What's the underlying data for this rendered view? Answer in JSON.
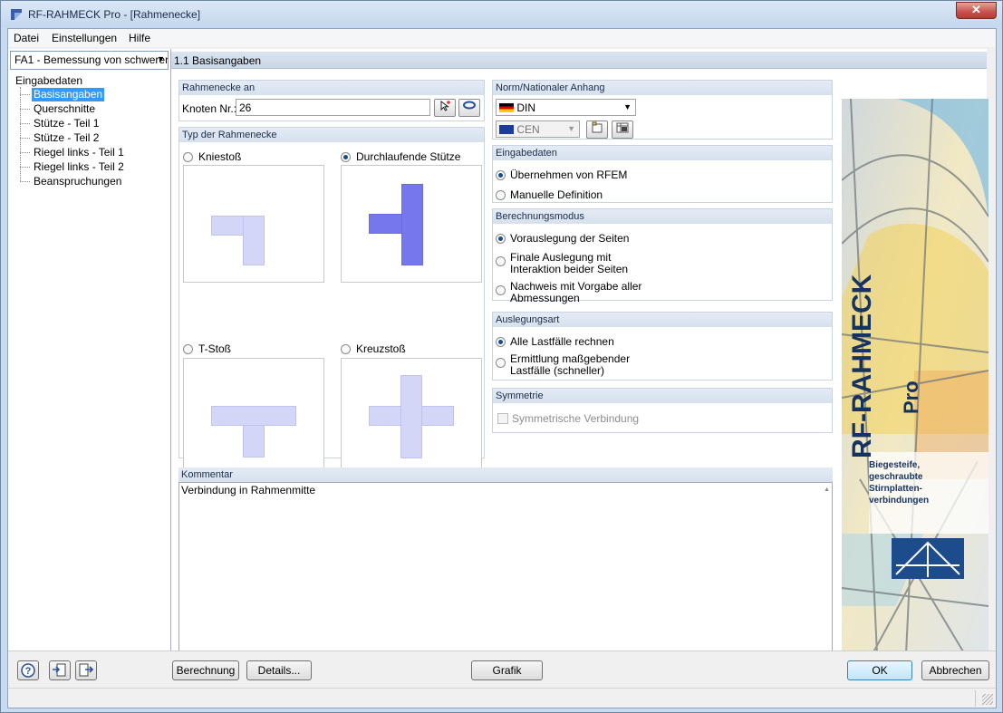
{
  "window": {
    "title": "RF-RAHMECK Pro - [Rahmenecke]",
    "close_glyph": "✕"
  },
  "menu": [
    "Datei",
    "Einstellungen",
    "Hilfe"
  ],
  "case_select": {
    "value": "FA1 - Bemessung von schwerer"
  },
  "tree": {
    "root": "Eingabedaten",
    "items": [
      "Basisangaben",
      "Querschnitte",
      "Stütze - Teil 1",
      "Stütze - Teil 2",
      "Riegel links - Teil 1",
      "Riegel links - Teil 2",
      "Beanspruchungen"
    ],
    "selected_index": 0
  },
  "main_header": "1.1 Basisangaben",
  "rahmenecke_an": {
    "title": "Rahmenecke an",
    "knoten_label": "Knoten Nr.:",
    "knoten_value": "26"
  },
  "typ": {
    "title": "Typ der Rahmenecke",
    "options": [
      "Kniestoß",
      "Durchlaufende Stütze",
      "T-Stoß",
      "Kreuzstoß"
    ],
    "selected_index": 1
  },
  "norm": {
    "title": "Norm/Nationaler Anhang",
    "norm_value": "DIN",
    "annex_value": "CEN"
  },
  "eingabedaten": {
    "title": "Eingabedaten",
    "options": [
      "Übernehmen von RFEM",
      "Manuelle Definition"
    ],
    "selected_index": 0
  },
  "berechnungsmodus": {
    "title": "Berechnungsmodus",
    "options": [
      {
        "line1": "Vorauslegung der Seiten",
        "line2": ""
      },
      {
        "line1": "Finale Auslegung mit",
        "line2": "Interaktion beider Seiten"
      },
      {
        "line1": "Nachweis mit Vorgabe aller",
        "line2": "Abmessungen"
      }
    ],
    "selected_index": 0
  },
  "auslegungsart": {
    "title": "Auslegungsart",
    "options": [
      {
        "line1": "Alle Lastfälle rechnen",
        "line2": ""
      },
      {
        "line1": "Ermittlung maßgebender",
        "line2": "Lastfälle (schneller)"
      }
    ],
    "selected_index": 0
  },
  "symmetrie": {
    "title": "Symmetrie",
    "checkbox_label": "Symmetrische Verbindung",
    "checked": false
  },
  "kommentar": {
    "title": "Kommentar",
    "text": "Verbindung in Rahmenmitte"
  },
  "side_banner": {
    "product": "RF-RAHMECK",
    "edition": "Pro",
    "desc_lines": [
      "Biegesteife,",
      "geschraubte",
      "Stirnplatten-",
      "verbindungen"
    ]
  },
  "buttons": {
    "berechnung": "Berechnung",
    "details": "Details...",
    "grafik": "Grafik",
    "ok": "OK",
    "abbrechen": "Abbrechen"
  },
  "colors": {
    "accent_blue": "#7677ec",
    "light_blue": "#d4d6f7",
    "header_bg": "#c8d6e6"
  }
}
